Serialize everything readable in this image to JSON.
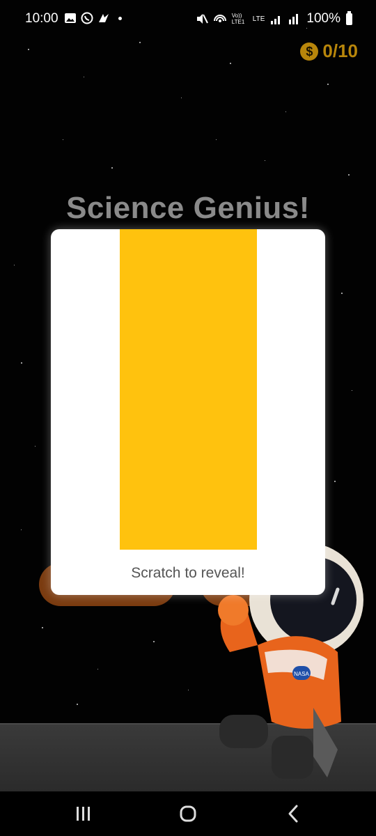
{
  "status_bar": {
    "time": "10:00",
    "battery": "100%",
    "left_icons": [
      "gallery-icon",
      "whatsapp-icon",
      "app-icon",
      "dot-icon"
    ],
    "right_icons": [
      "mute-icon",
      "hotspot-icon",
      "volte-icon",
      "lte-icon",
      "signal-icon",
      "signal-r-icon",
      "battery-icon"
    ],
    "volte_label": "Vo)) LTE1",
    "lte_label": "LTE"
  },
  "coins": {
    "icon": "dollar-coin-icon",
    "symbol": "$",
    "count": "0/10"
  },
  "title": "Science Genius!",
  "card": {
    "scratch_color": "#ffc20e",
    "label": "Scratch to reveal!"
  },
  "nav": {
    "recents_icon": "recents-icon",
    "home_icon": "home-icon",
    "back_icon": "back-icon"
  },
  "badge": "NASA",
  "colors": {
    "coin": "#b8860b",
    "title": "#8a8a8a",
    "card": "#ffffff",
    "scratch": "#ffc20e",
    "button_bg": "#7a3b10"
  }
}
